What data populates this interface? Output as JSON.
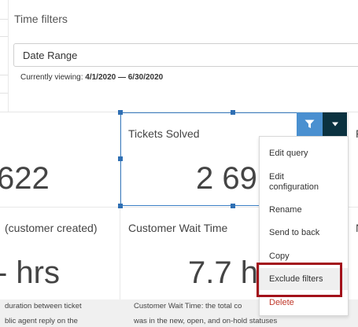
{
  "filters": {
    "title": "Time filters",
    "date_range_label": "Date Range",
    "viewing_prefix": "Currently viewing:",
    "viewing_range": "4/1/2020 — 6/30/2020"
  },
  "tiles": {
    "a_value": "622",
    "b_title": "Tickets Solved",
    "b_value": "2 69.",
    "c_title_partial": "F",
    "row2_a_title": "(customer created)",
    "row2_a_value": "- hrs",
    "row2_b_title": "Customer Wait Time",
    "row2_b_value": "7.7 h",
    "row2_c_title_partial": "N"
  },
  "descriptions": {
    "a_line1": "duration between ticket",
    "a_line2": "blic agent reply on the",
    "b_line1": "Customer Wait Time: the total co",
    "b_line2": "was in the new, open, and on-hold statuses"
  },
  "toolbar": {
    "filter_icon": "filter-icon",
    "menu_icon": "caret-down-icon",
    "filter_color": "#4a90d0",
    "menu_color": "#0b3240"
  },
  "menu": {
    "items": [
      "Edit query",
      "Edit configuration",
      "Rename",
      "Send to back",
      "Copy",
      "Exclude filters",
      "Delete"
    ],
    "edit_configuration_line1": "Edit",
    "edit_configuration_line2": "configuration",
    "highlight_color": "#a3121b"
  }
}
